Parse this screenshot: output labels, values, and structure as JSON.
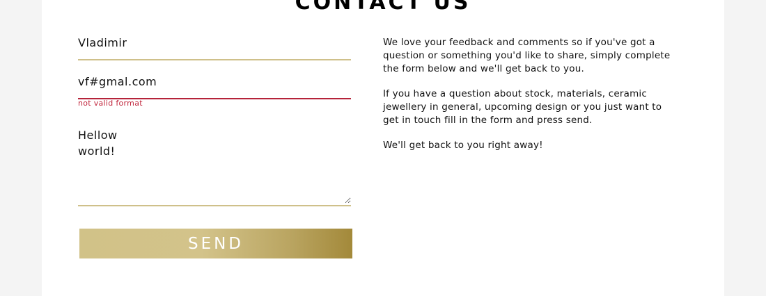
{
  "page": {
    "title": "CONTACT US"
  },
  "form": {
    "name_value": "Vladimir",
    "email_value": "vf#gmal.com",
    "email_error": "not valid format",
    "message_value": "Hellow\nworld!",
    "send_label": "SEND"
  },
  "info": {
    "paragraphs": [
      "We love your feedback and comments so if you've got a question or something you'd like to share, simply complete the form below and we'll get back to you.",
      "If you have a question about stock, materials, ceramic jewellery in general, upcoming design or you just want to get in touch fill in the form and press send.",
      "We'll get back to you right away!"
    ]
  },
  "colors": {
    "gold_underline": "#cfc08a",
    "error_red": "#c0233a",
    "button_gradient_start": "#d1c288",
    "button_gradient_end": "#a3893a"
  }
}
